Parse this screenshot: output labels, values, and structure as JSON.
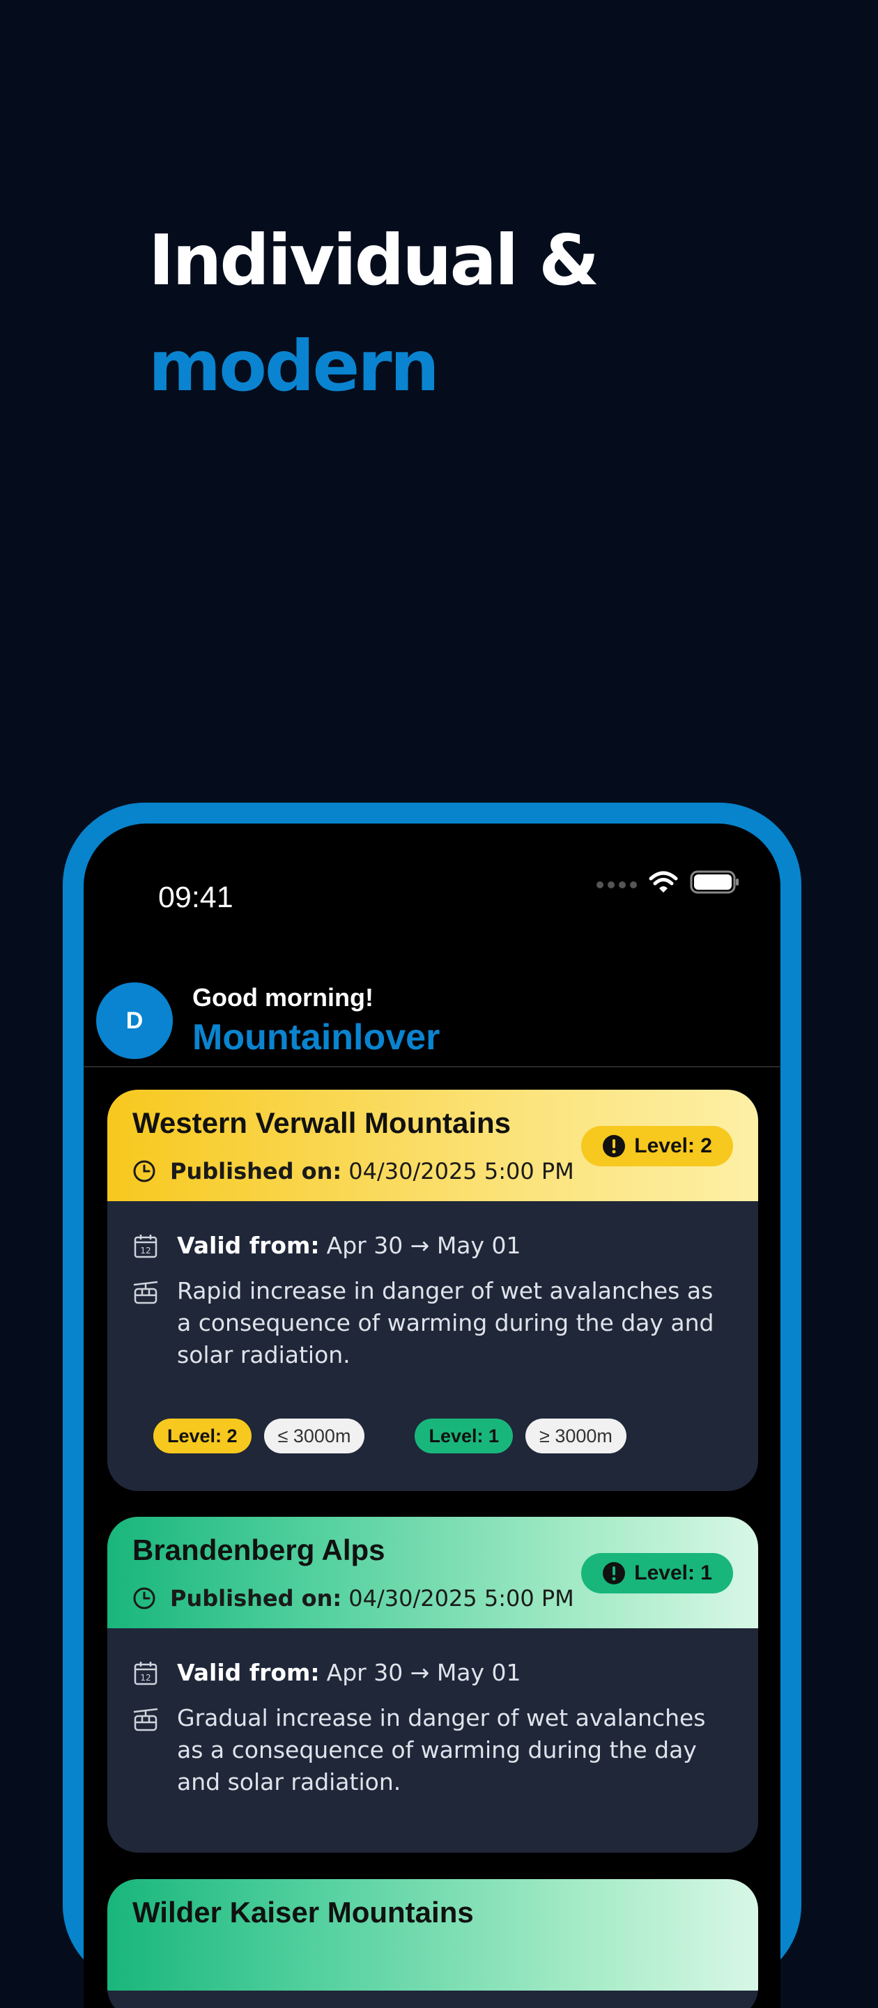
{
  "hero": {
    "line1": "Individual &",
    "line2": "modern"
  },
  "status_bar": {
    "time": "09:41"
  },
  "header": {
    "avatar_initial": "D",
    "greeting": "Good morning!",
    "username": "Mountainlover"
  },
  "cards": [
    {
      "title": "Western Verwall Mountains",
      "published_label": "Published on:",
      "published_value": "04/30/2025 5:00 PM",
      "level_label": "Level: 2",
      "valid_label": "Valid from:",
      "valid_value": "Apr 30 → May 01",
      "description": "Rapid increase in danger of wet avalanches as a consequence of warming during the day and solar radiation.",
      "chips": [
        "Level: 2",
        "≤ 3000m",
        "Level: 1",
        "≥ 3000m"
      ]
    },
    {
      "title": "Brandenberg Alps",
      "published_label": "Published on:",
      "published_value": "04/30/2025 5:00 PM",
      "level_label": "Level: 1",
      "valid_label": "Valid from:",
      "valid_value": "Apr 30 → May 01",
      "description": "Gradual increase in danger of wet avalanches as a consequence of warming during the day and solar radiation."
    },
    {
      "title": "Wilder Kaiser Mountains"
    }
  ],
  "colors": {
    "background": "#050d1d",
    "accent": "#0a84d0",
    "level1": "#19b67c",
    "level2": "#f7c81e",
    "card_body": "#1f2739"
  }
}
